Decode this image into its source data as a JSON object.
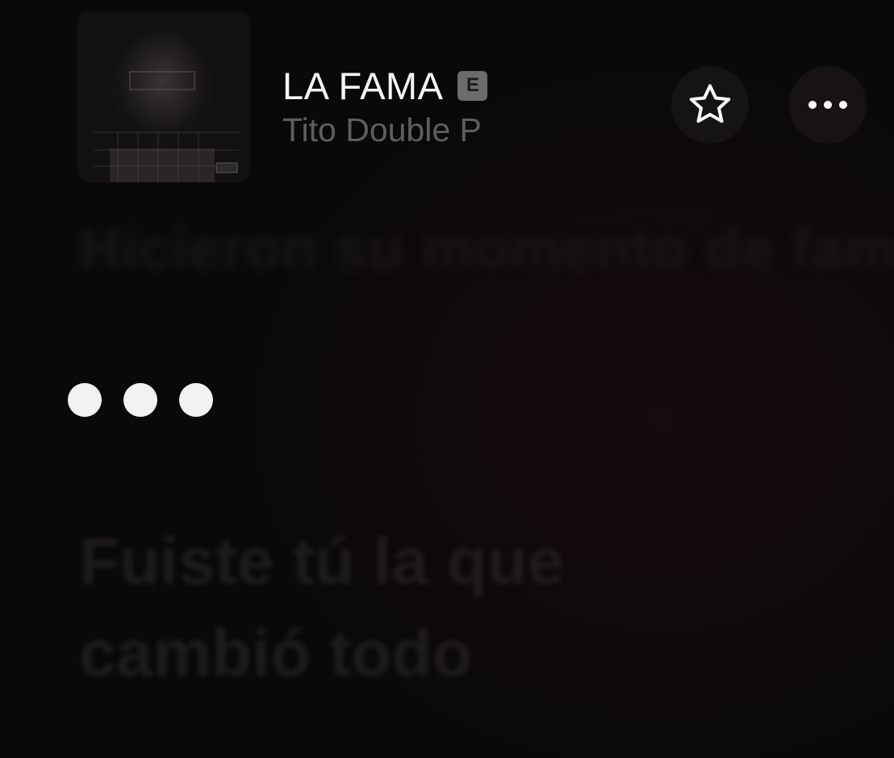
{
  "now_playing": {
    "title": "LA FAMA",
    "explicit_badge": "E",
    "artist": "Tito Double P",
    "artwork_icon": "album-artwork"
  },
  "actions": {
    "favorite_icon": "star-icon",
    "more_icon": "ellipsis-icon"
  },
  "lyrics": {
    "previous_line": "Hicieron su momento de fama",
    "current_indicator": "instrumental-dots",
    "next_line": "Fuiste tú la que cambió todo"
  },
  "colors": {
    "background": "#0a0909",
    "title": "#f4f4f4",
    "artist": "#5f5d5e",
    "badge": "#6d6b6c",
    "dots": "#f2f2f2"
  }
}
